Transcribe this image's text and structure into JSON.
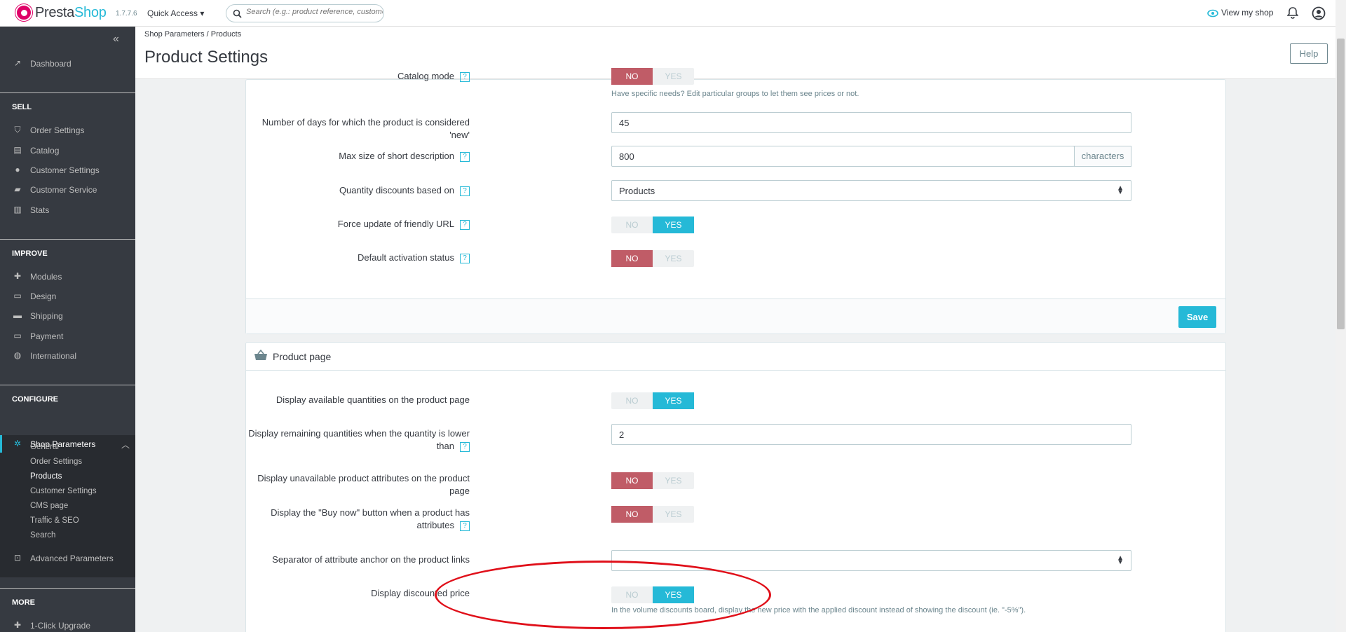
{
  "header": {
    "brand_presta": "Presta",
    "brand_shop": "Shop",
    "version": "1.7.7.6",
    "quick_access": "Quick Access ▾",
    "search_placeholder": "Search (e.g.: product reference, customer name...)",
    "view_shop": "View my shop"
  },
  "sidebar": {
    "dashboard": "Dashboard",
    "sell": "SELL",
    "sell_items": [
      "Order Settings",
      "Catalog",
      "Customer Settings",
      "Customer Service",
      "Stats"
    ],
    "improve": "IMPROVE",
    "improve_items": [
      "Modules",
      "Design",
      "Shipping",
      "Payment",
      "International"
    ],
    "configure": "CONFIGURE",
    "shop_parameters": "Shop Parameters",
    "sub_items": [
      "General",
      "Order Settings",
      "Products",
      "Customer Settings",
      "CMS page",
      "Traffic & SEO",
      "Search"
    ],
    "advanced": "Advanced Parameters",
    "more": "MORE",
    "upgrade": "1-Click Upgrade"
  },
  "page": {
    "crumb_1": "Shop Parameters",
    "crumb_sep": "/",
    "crumb_2": "Products",
    "title": "Product Settings",
    "help": "Help"
  },
  "general": {
    "catalog_mode_label": "Catalog mode",
    "catalog_hint": "Have specific needs? Edit particular groups to let them see prices or not.",
    "days_new_label": "Number of days for which the product is considered 'new'",
    "days_new_value": "45",
    "short_desc_label": "Max size of short description",
    "short_desc_value": "800",
    "short_desc_addon": "characters",
    "qty_discount_label": "Quantity discounts based on",
    "qty_discount_value": "Products",
    "force_url_label": "Force update of friendly URL",
    "default_status_label": "Default activation status",
    "save": "Save"
  },
  "toggle": {
    "no": "NO",
    "yes": "YES"
  },
  "product_page": {
    "title": "Product page",
    "avail_qty_label": "Display available quantities on the product page",
    "remaining_label_1": "Display remaining quantities when the quantity is lower",
    "remaining_label_2": "than",
    "remaining_value": "2",
    "unavail_attr_label": "Display unavailable product attributes on the product page",
    "buy_now_label_1": "Display the \"Buy now\" button when a product has",
    "buy_now_label_2": "attributes",
    "separator_label": "Separator of attribute anchor on the product links",
    "discounted_label": "Display discounted price",
    "discounted_hint": "In the volume discounts board, display the new price with the applied discount instead of showing the discount (ie. \"-5%\")."
  },
  "colors": {
    "accent": "#25b9d7",
    "no_active": "#c05c67",
    "sidebar": "#363a41",
    "annotation": "#e0101a"
  }
}
